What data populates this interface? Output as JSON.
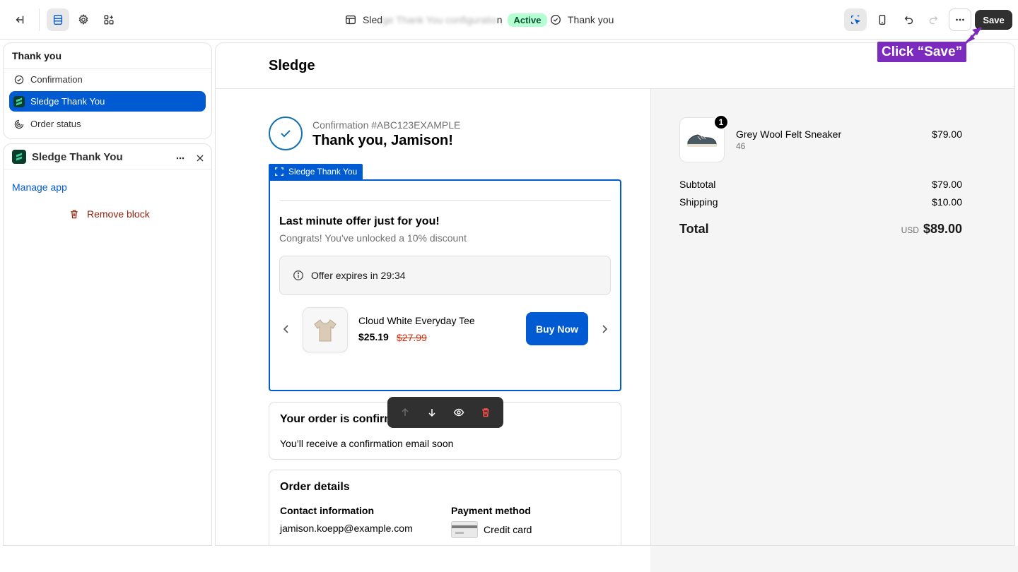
{
  "topbar": {
    "store_name_prefix": "Sled",
    "store_name_blurred": "ge Thank You configuratio",
    "store_name_suffix": "n",
    "status": "Active",
    "page_name": "Thank you",
    "save_label": "Save"
  },
  "left_panel": {
    "section_title": "Thank you",
    "items": [
      {
        "label": "Confirmation"
      },
      {
        "label": "Sledge Thank You"
      },
      {
        "label": "Order status"
      }
    ],
    "app_block": {
      "title": "Sledge Thank You",
      "manage_link": "Manage app",
      "remove_label": "Remove block"
    }
  },
  "preview": {
    "shop_name": "Sledge",
    "confirmation_number": "Confirmation #ABC123EXAMPLE",
    "thank_you": "Thank you, Jamison!",
    "block_tag": "Sledge Thank You",
    "offer": {
      "title": "Last minute offer just for you!",
      "subtitle": "Congrats! You've unlocked a 10% discount",
      "expires": "Offer expires in 29:34",
      "product_name": "Cloud White Everyday Tee",
      "price": "$25.19",
      "compare_price": "$27.99",
      "buy_label": "Buy Now"
    },
    "order_confirmed": {
      "title": "Your order is confirmed",
      "text": "You’ll receive a confirmation email soon"
    },
    "order_details": {
      "title": "Order details",
      "contact_label": "Contact information",
      "contact_value": "jamison.koepp@example.com",
      "payment_label": "Payment method",
      "payment_value": "Credit card"
    },
    "summary": {
      "quantity": "1",
      "product_name": "Grey Wool Felt Sneaker",
      "variant": "46",
      "product_price": "$79.00",
      "subtotal_label": "Subtotal",
      "subtotal_value": "$79.00",
      "shipping_label": "Shipping",
      "shipping_value": "$10.00",
      "total_label": "Total",
      "currency": "USD",
      "total_value": "$89.00"
    }
  },
  "annotation": {
    "text": "Click “Save”"
  },
  "colors": {
    "accent": "#005bd3",
    "active_badge": "#b4fed2",
    "callout": "#7b2cbf",
    "danger": "#d72c0d"
  }
}
